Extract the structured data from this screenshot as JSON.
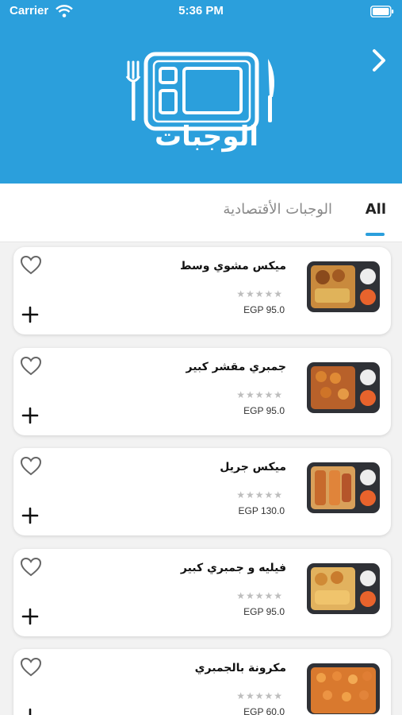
{
  "status_bar": {
    "carrier": "Carrier",
    "time": "5:36 PM"
  },
  "header": {
    "logo_text": "الوجبات",
    "brand_color": "#2b9fdc"
  },
  "tabs": [
    {
      "label": "All",
      "active": true
    },
    {
      "label": "الوجبات الأقتصادية",
      "active": false
    }
  ],
  "meals": [
    {
      "name": "ميكس مشوي وسط",
      "price": "EGP 95.0",
      "rating": "★★★★★"
    },
    {
      "name": "جمبري  مقشر كبير",
      "price": "EGP 95.0",
      "rating": "★★★★★"
    },
    {
      "name": "ميكس جريل",
      "price": "EGP 130.0",
      "rating": "★★★★★"
    },
    {
      "name": "فيليه و جمبري كبير",
      "price": "EGP 95.0",
      "rating": "★★★★★"
    },
    {
      "name": "مكرونة بالجمبري",
      "price": "EGP 60.0",
      "rating": "★★★★★"
    }
  ],
  "icons": {
    "back": "chevron-right-icon",
    "favorite": "heart-icon",
    "add": "plus-icon"
  }
}
